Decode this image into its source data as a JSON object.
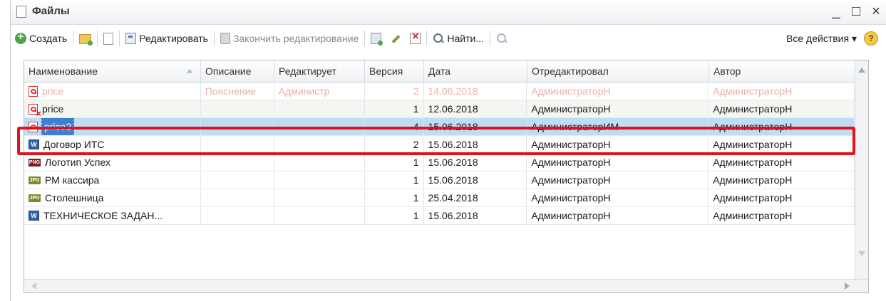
{
  "window": {
    "title": "Файлы",
    "controls": {
      "minimize": "_",
      "maximize": "□",
      "close": "×"
    }
  },
  "toolbar": {
    "create": "Создать",
    "edit": "Редактировать",
    "finish_editing": "Закончить редактирование",
    "find": "Найти...",
    "all_actions": "Все действия",
    "all_actions_arrow": "▾",
    "help": "?"
  },
  "table": {
    "columns": [
      "Наименование",
      "Описание",
      "Редактирует",
      "Версия",
      "Дата",
      "Отредактировал",
      "Автор"
    ],
    "rows": [
      {
        "icon": "pdf",
        "name": "price",
        "description": "Пояснение",
        "editing": "Администр",
        "version": "2",
        "date": "14.06.2018",
        "edited_by": "АдминистраторН",
        "author": "АдминистраторН",
        "state": "faded"
      },
      {
        "icon": "pdf-deleted",
        "name": "price",
        "description": "",
        "editing": "",
        "version": "1",
        "date": "12.06.2018",
        "edited_by": "АдминистраторН",
        "author": "АдминистраторН",
        "state": "alt"
      },
      {
        "icon": "pdf",
        "name": "price2",
        "description": "",
        "editing": "",
        "version": "4",
        "date": "15.06.2018",
        "edited_by": "АдминистраторИМ",
        "author": "АдминистраторН",
        "state": "selected"
      },
      {
        "icon": "word",
        "name": "Договор ИТС",
        "description": "",
        "editing": "",
        "version": "2",
        "date": "15.06.2018",
        "edited_by": "АдминистраторН",
        "author": "АдминистраторН",
        "state": "normal"
      },
      {
        "icon": "png",
        "name": "Логотип Успех",
        "description": "",
        "editing": "",
        "version": "1",
        "date": "15.06.2018",
        "edited_by": "АдминистраторН",
        "author": "АдминистраторН",
        "state": "normal"
      },
      {
        "icon": "jpg",
        "name": "РМ кассира",
        "description": "",
        "editing": "",
        "version": "1",
        "date": "15.06.2018",
        "edited_by": "АдминистраторН",
        "author": "АдминистраторН",
        "state": "normal"
      },
      {
        "icon": "jpg",
        "name": "Столешница",
        "description": "",
        "editing": "",
        "version": "1",
        "date": "25.04.2018",
        "edited_by": "АдминистраторН",
        "author": "АдминистраторН",
        "state": "normal"
      },
      {
        "icon": "word",
        "name": "ТЕХНИЧЕСКОЕ ЗАДАН...",
        "description": "",
        "editing": "",
        "version": "1",
        "date": "15.06.2018",
        "edited_by": "АдминистраторН",
        "author": "АдминистраторН",
        "state": "normal"
      }
    ]
  },
  "colors": {
    "selected_row": "#bfdcf5",
    "highlight_frame": "#e0131a",
    "selection_text_bg": "#3d7fd3"
  }
}
